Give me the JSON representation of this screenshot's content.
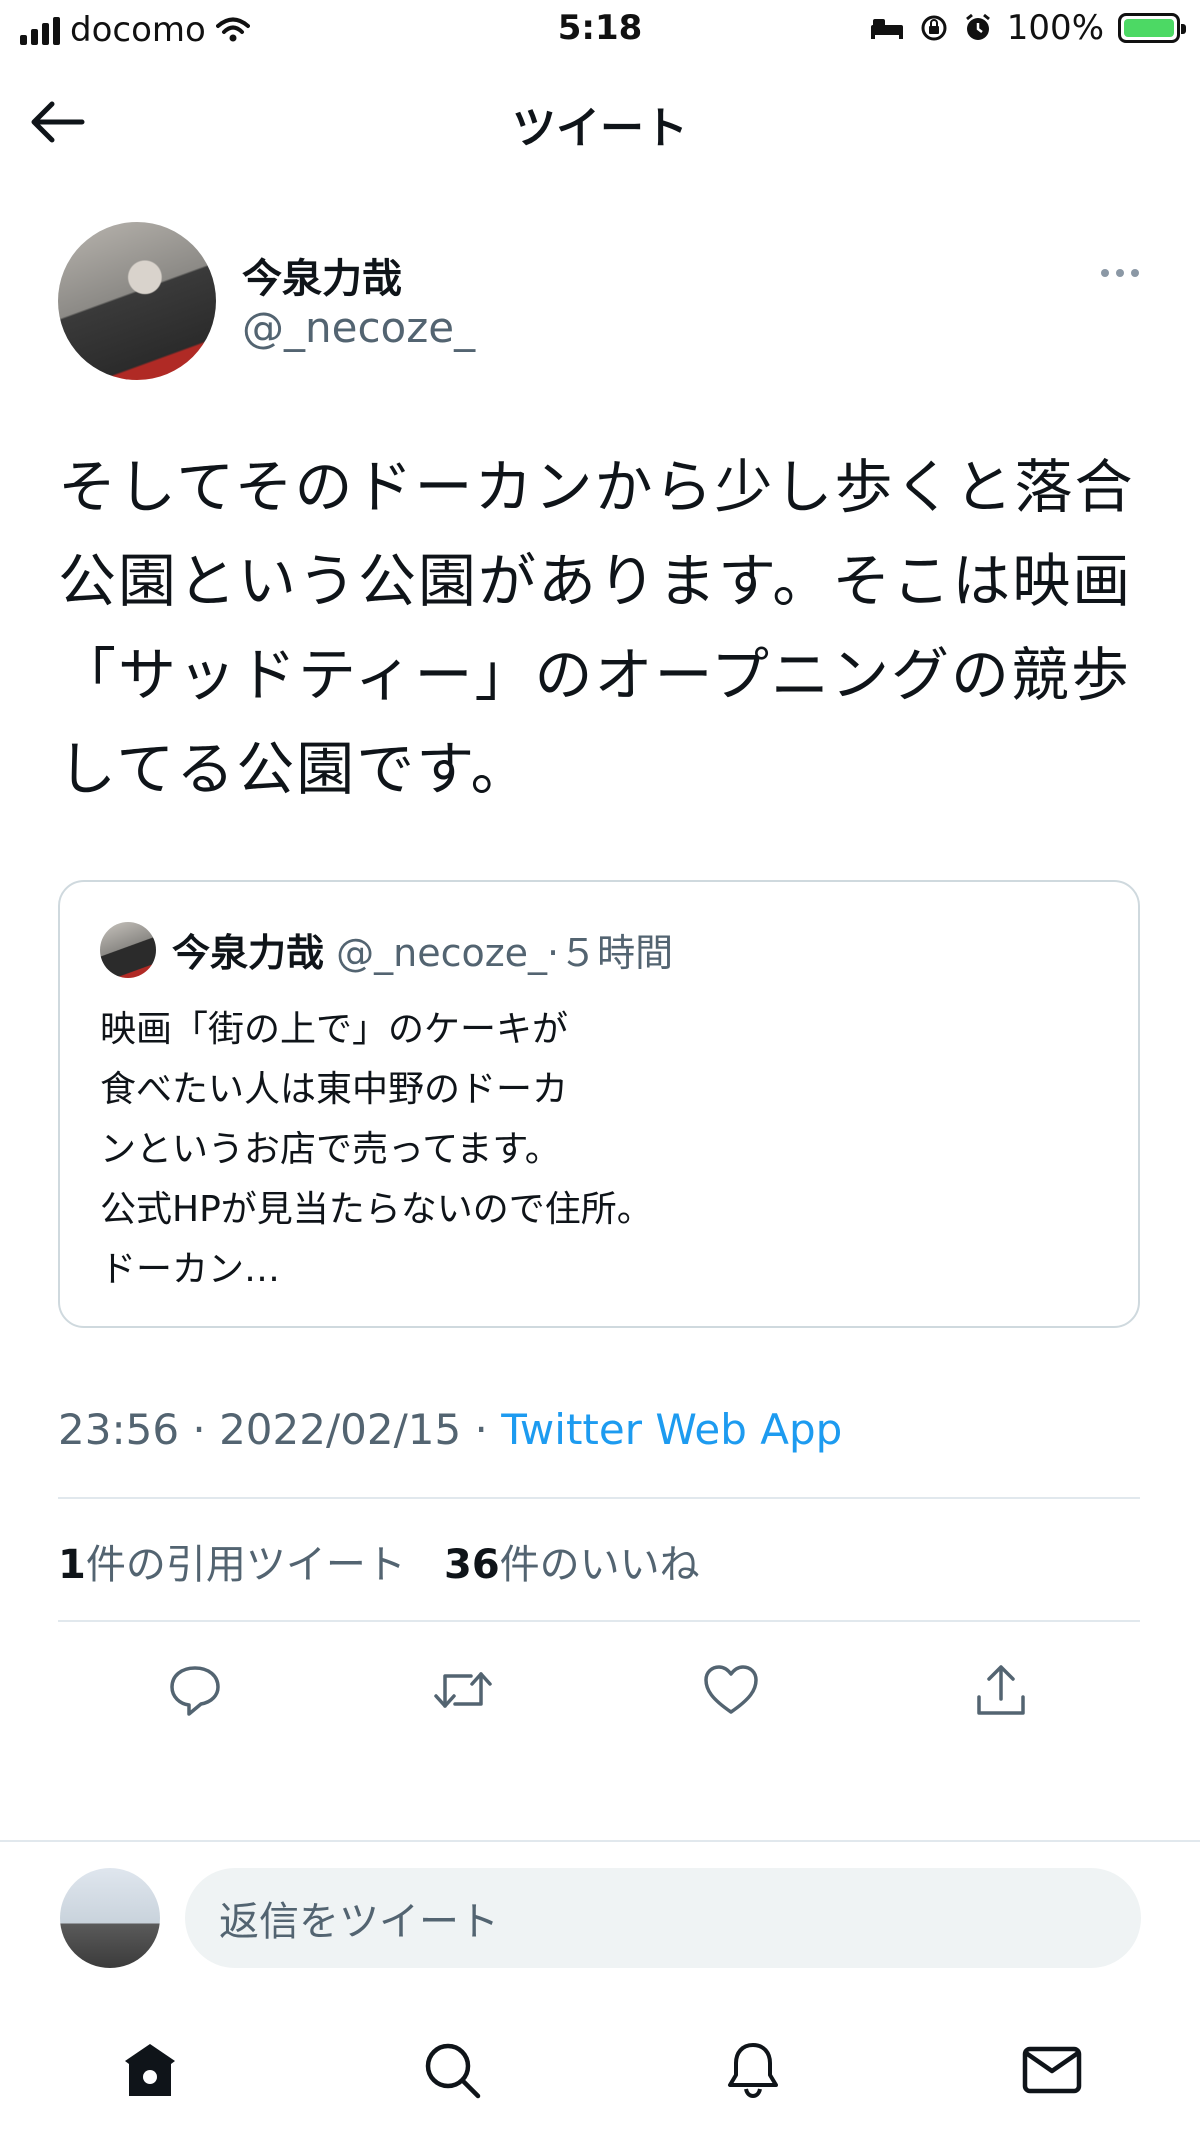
{
  "status_bar": {
    "carrier": "docomo",
    "time": "5:18",
    "battery": "100%"
  },
  "header": {
    "title": "ツイート"
  },
  "tweet": {
    "author_name": "今泉力哉",
    "author_handle": "@_necoze_",
    "text": "そしてそのドーカンから少し歩くと落合公園という公園があります。そこは映画「サッドティー」のオープニングの競歩してる公園です。",
    "quote": {
      "author_name": "今泉力哉",
      "author_handle": "@_necoze_",
      "time_ago": "·５時間",
      "lines": [
        "映画「街の上で」のケーキが",
        "食べたい人は東中野のドーカ",
        "ンというお店で売ってます。",
        "公式HPが見当たらないので住所。",
        "ドーカン…"
      ]
    },
    "timestamp": "23:56 · 2022/02/15 · ",
    "source": "Twitter Web App",
    "stats": {
      "quote_count": "1",
      "quote_label": "件の引用ツイート",
      "like_count": "36",
      "like_label": "件のいいね"
    }
  },
  "reply": {
    "placeholder": "返信をツイート"
  },
  "icons": {
    "actions": [
      "reply-icon",
      "retweet-icon",
      "like-icon",
      "share-icon"
    ],
    "nav": [
      "home-icon",
      "search-icon",
      "notifications-icon",
      "messages-icon"
    ]
  },
  "colors": {
    "accent": "#1d9bf0",
    "secondary_text": "#536471",
    "battery_fill": "#4cd964"
  }
}
